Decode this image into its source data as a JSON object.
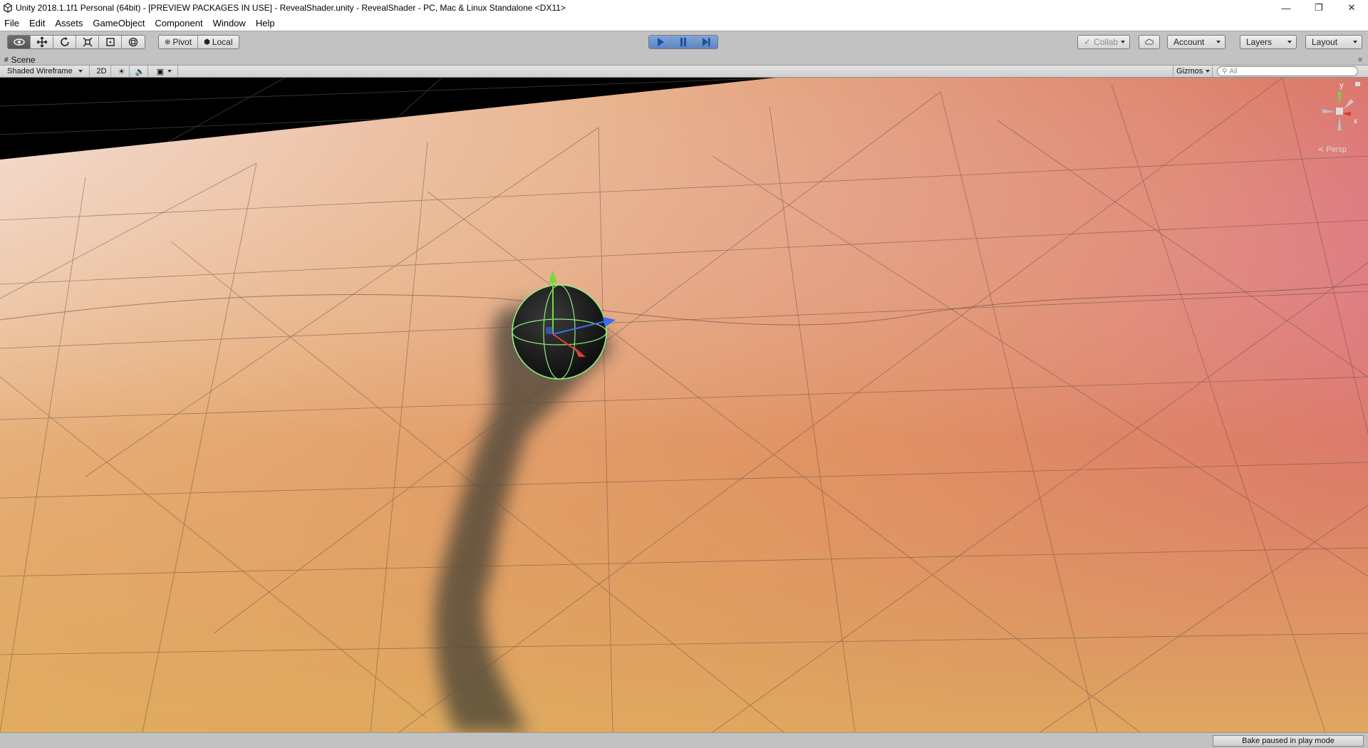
{
  "window": {
    "title": "Unity 2018.1.1f1 Personal (64bit) - [PREVIEW PACKAGES IN USE] - RevealShader.unity - RevealShader - PC, Mac & Linux Standalone <DX11>",
    "app_icon": "unity-icon",
    "controls": {
      "minimize": "—",
      "restore": "❐",
      "close": "✕"
    }
  },
  "menu": [
    "File",
    "Edit",
    "Assets",
    "GameObject",
    "Component",
    "Window",
    "Help"
  ],
  "toolbar": {
    "tools": [
      {
        "name": "view-tool",
        "icon": "eye-icon",
        "active": true
      },
      {
        "name": "move-tool",
        "icon": "move-arrows-icon",
        "active": false
      },
      {
        "name": "rotate-tool",
        "icon": "rotate-icon",
        "active": false
      },
      {
        "name": "scale-tool",
        "icon": "scale-icon",
        "active": false
      },
      {
        "name": "rect-tool",
        "icon": "rect-icon",
        "active": false
      },
      {
        "name": "transform-tool",
        "icon": "transform-icon",
        "active": false
      }
    ],
    "pivot_label": "Pivot",
    "local_label": "Local",
    "play_controls": [
      "play-icon",
      "pause-icon",
      "step-icon"
    ],
    "collab_label": "Collab",
    "account_label": "Account",
    "layers_label": "Layers",
    "layout_label": "Layout"
  },
  "scene": {
    "tab_label": "Scene",
    "shading_mode": "Shaded Wireframe",
    "btn_2d": "2D",
    "gizmos_label": "Gizmos",
    "search_placeholder": "All",
    "persp_label": "Persp",
    "axis_labels": {
      "y": "y",
      "x": "x"
    }
  },
  "status": {
    "message": "Bake paused in play mode"
  },
  "colors": {
    "editor_bg": "#c2c2c2",
    "play_active": "#5a85c4",
    "terrain_warm": "#e0a85e",
    "terrain_pink": "#d4437c"
  }
}
